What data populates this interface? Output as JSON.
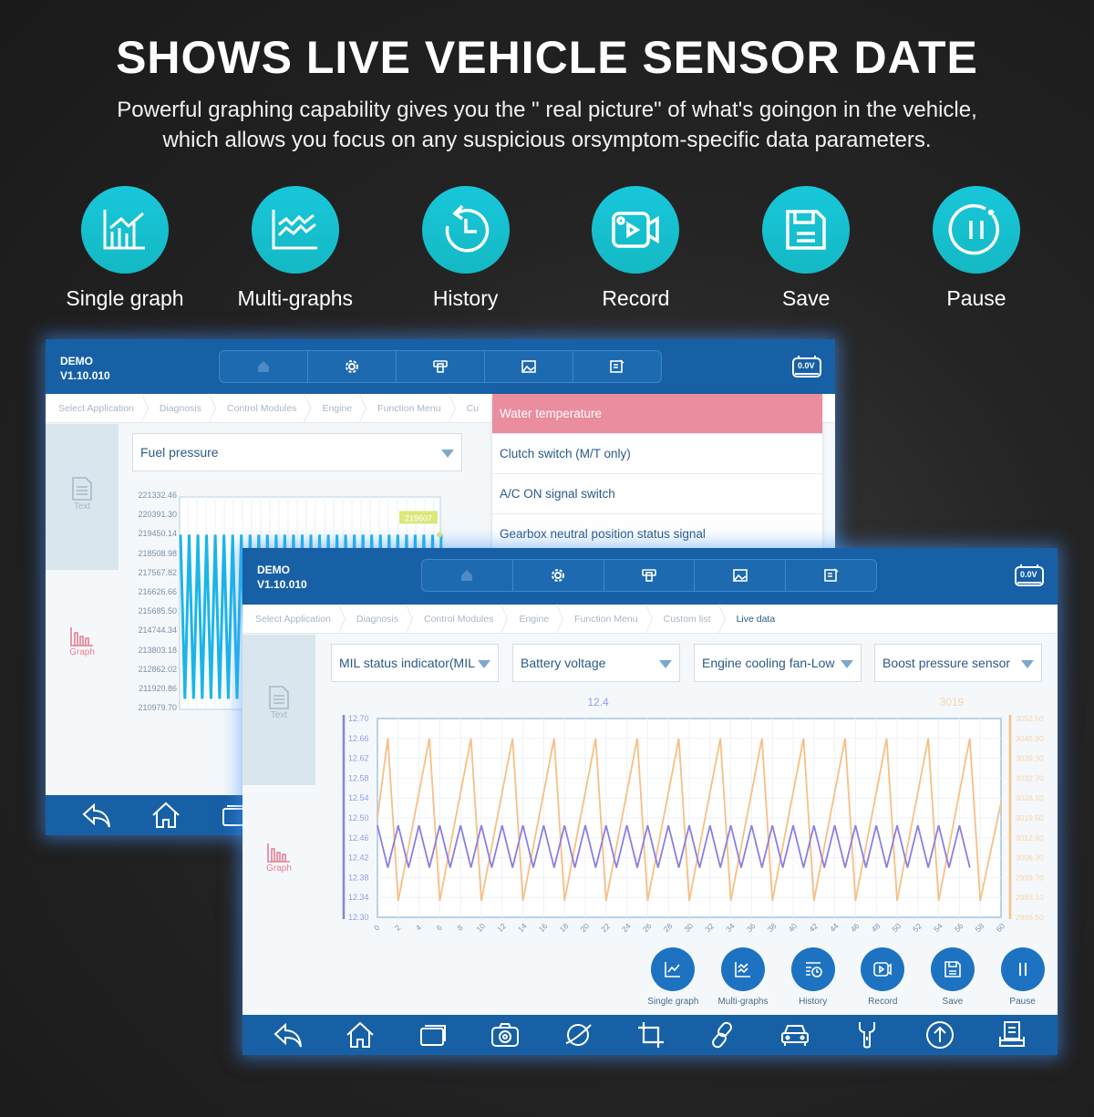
{
  "headline": "SHOWS LIVE VEHICLE SENSOR DATE",
  "subtitle_line1": "Powerful graphing capability gives you the \" real picture\" of what's goingon in the vehicle,",
  "subtitle_line2": "which allows you focus on any suspicious orsymptom-specific data parameters.",
  "features": [
    {
      "label": "Single graph",
      "icon": "single-graph-icon"
    },
    {
      "label": "Multi-graphs",
      "icon": "multi-graphs-icon"
    },
    {
      "label": "History",
      "icon": "history-icon"
    },
    {
      "label": "Record",
      "icon": "record-icon"
    },
    {
      "label": "Save",
      "icon": "save-icon"
    },
    {
      "label": "Pause",
      "icon": "pause-icon"
    }
  ],
  "tablet_back": {
    "app_name": "DEMO",
    "version": "V1.10.010",
    "battery": "0.0V",
    "breadcrumbs": [
      "Select Application",
      "Diagnosis",
      "Control Modules",
      "Engine",
      "Function Menu",
      "Cu"
    ],
    "side_text": "Text",
    "side_graph": "Graph",
    "dropdown": "Fuel pressure",
    "menu_items": [
      "Water temperature",
      "Clutch switch (M/T only)",
      "A/C ON signal switch",
      "Gearbox neutral position status signal"
    ],
    "selected_menu_item": 0,
    "value_badge": "219607"
  },
  "tablet_front": {
    "app_name": "DEMO",
    "version": "V1.10.010",
    "battery": "0.0V",
    "breadcrumbs": [
      "Select Application",
      "Diagnosis",
      "Control Modules",
      "Engine",
      "Function Menu",
      "Custom list",
      "Live data"
    ],
    "side_text": "Text",
    "side_graph": "Graph",
    "dropdowns": [
      "MIL status indicator(MIL",
      "Battery voltage",
      "Engine cooling fan-Low",
      "Boost pressure sensor"
    ],
    "actions": [
      "Single graph",
      "Multi-graphs",
      "History",
      "Record",
      "Save",
      "Pause"
    ],
    "bottom_nav": [
      "back-icon",
      "home-icon",
      "windows-icon",
      "camera-icon",
      "browser-icon",
      "crop-icon",
      "link-icon",
      "car-icon",
      "wrench-icon",
      "upload-icon",
      "report-icon"
    ]
  },
  "chart_data": [
    {
      "type": "line",
      "title": "Fuel pressure",
      "ylim": [
        210979.7,
        221332.46
      ],
      "yticks": [
        "221332.46",
        "220391.30",
        "219450.14",
        "218508.98",
        "217567.82",
        "216626.66",
        "215685.50",
        "214744.34",
        "213803.18",
        "212862.02",
        "211920.86",
        "210979.70"
      ],
      "series": [
        {
          "name": "Fuel pressure",
          "color": "#1bb5e8",
          "high": 219450.14,
          "low": 211450.0,
          "cycles": 30
        }
      ],
      "annotation": "219607"
    },
    {
      "type": "line",
      "x": [
        0,
        60
      ],
      "xticks": [
        0,
        2,
        4,
        6,
        8,
        10,
        12,
        14,
        16,
        18,
        20,
        22,
        24,
        26,
        28,
        30,
        32,
        34,
        36,
        38,
        40,
        42,
        44,
        46,
        48,
        50,
        52,
        54,
        56,
        58,
        60
      ],
      "left_axis": {
        "ylim": [
          12.3,
          12.7
        ],
        "ticks": [
          "12.70",
          "12.66",
          "12.62",
          "12.58",
          "12.54",
          "12.50",
          "12.46",
          "12.42",
          "12.38",
          "12.34",
          "12.30"
        ],
        "color": "#8b7fe0"
      },
      "right_axis": {
        "ylim": [
          2986.5,
          3052.5
        ],
        "ticks": [
          "3052.50",
          "3045.90",
          "3039.30",
          "3032.70",
          "3026.10",
          "3019.50",
          "3012.90",
          "3006.30",
          "2999.70",
          "2993.10",
          "2986.50"
        ],
        "color": "#f7bf85"
      },
      "series": [
        {
          "name": "Battery voltage",
          "axis": "left",
          "color": "#8b7fe0",
          "current": "12.4",
          "pattern": "triangle",
          "high": 12.485,
          "low": 12.4,
          "period": 2,
          "x_end": 57
        },
        {
          "name": "Boost pressure sensor",
          "axis": "right",
          "color": "#f7bf85",
          "current": "3019",
          "pattern": "sawtooth",
          "start": 3019.5,
          "high": 3045.9,
          "low": 2992.0,
          "period": 4,
          "x_end": 60
        }
      ]
    }
  ]
}
